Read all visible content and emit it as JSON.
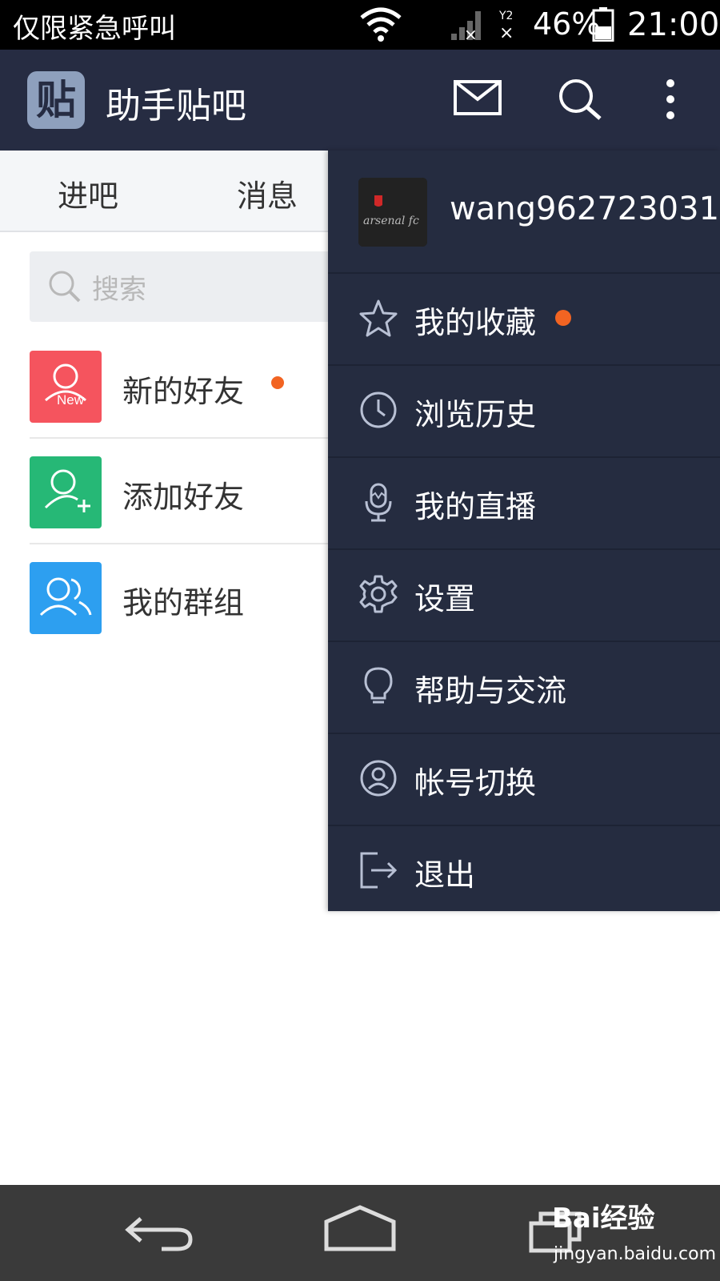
{
  "status_bar": {
    "carrier": "仅限紧急呼叫",
    "battery": "46%",
    "time": "21:00"
  },
  "app_bar": {
    "logo": "贴",
    "title": "助手贴吧"
  },
  "tabs": [
    "进吧",
    "消息"
  ],
  "search": {
    "placeholder": "搜索"
  },
  "contacts": {
    "items": [
      {
        "label": "新的好友",
        "badge_text": "New",
        "color": "#f5545e",
        "has_dot": true
      },
      {
        "label": "添加好友",
        "color": "#26b876",
        "has_dot": false
      },
      {
        "label": "我的群组",
        "color": "#2d9ff0",
        "has_dot": false
      }
    ]
  },
  "drawer": {
    "username": "wang962723031",
    "avatar_text": "arsenal fc",
    "items": [
      {
        "label": "我的收藏",
        "icon": "star-icon",
        "has_dot": true
      },
      {
        "label": "浏览历史",
        "icon": "clock-icon"
      },
      {
        "label": "我的直播",
        "icon": "microphone-icon"
      },
      {
        "label": "设置",
        "icon": "gear-icon"
      },
      {
        "label": "帮助与交流",
        "icon": "lightbulb-icon"
      },
      {
        "label": "帐号切换",
        "icon": "user-circle-icon"
      },
      {
        "label": "退出",
        "icon": "logout-icon"
      }
    ]
  },
  "watermark": {
    "brand": "Bai经验",
    "url": "jingyan.baidu.com"
  },
  "colors": {
    "app_bar": "#262c42",
    "drawer": "#252c40",
    "notification_dot": "#f26422"
  }
}
